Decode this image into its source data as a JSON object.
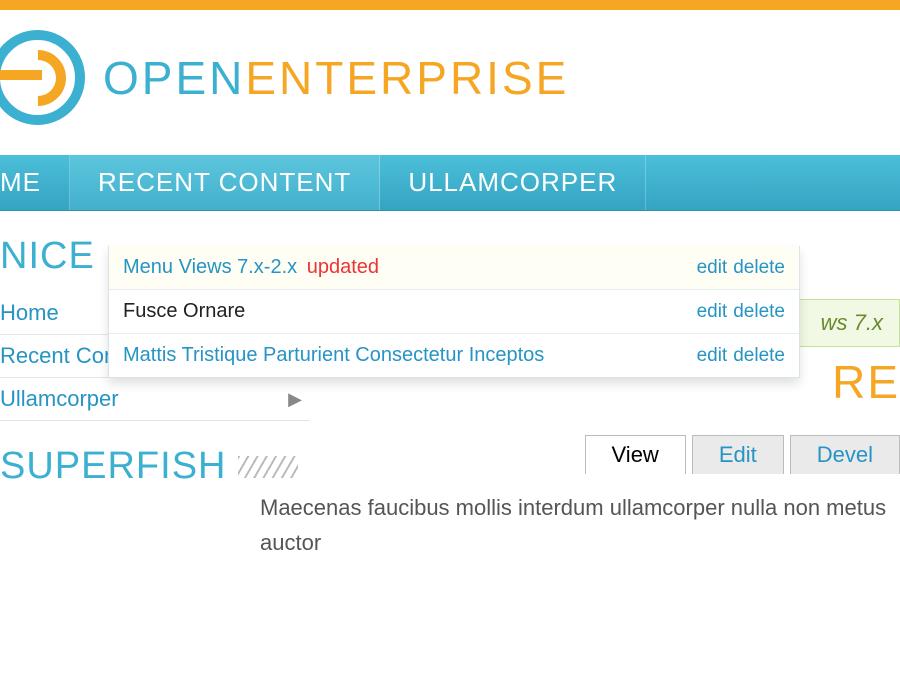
{
  "brand": {
    "word1": "OPEN",
    "word2": "ENTERPRISE"
  },
  "nav": [
    {
      "label": "HOME",
      "cropped": "ME"
    },
    {
      "label": "RECENT CONTENT",
      "active": true
    },
    {
      "label": "ULLAMCORPER"
    }
  ],
  "dropdown": [
    {
      "title": "Menu Views 7.x-2.x",
      "badge": "updated",
      "link": true,
      "highlight": true,
      "edit": "edit",
      "delete": "delete"
    },
    {
      "title": "Fusce Ornare",
      "link": false,
      "edit": "edit",
      "delete": "delete"
    },
    {
      "title": "Mattis Tristique Parturient Consectetur Inceptos",
      "link": true,
      "edit": "edit",
      "delete": "delete"
    }
  ],
  "sidebar": {
    "block1_title": "NICE",
    "block2_title": "SUPERFISH",
    "items": [
      {
        "label": "Home",
        "expandable": false
      },
      {
        "label": "Recent Content",
        "expandable": true
      },
      {
        "label": "Ullamcorper",
        "expandable": true
      }
    ]
  },
  "main": {
    "green_strip": "ws 7.x",
    "heading_fragment": "RE",
    "tabs": [
      {
        "label": "View",
        "active": true
      },
      {
        "label": "Edit"
      },
      {
        "label": "Devel"
      }
    ],
    "paragraph": "Maecenas faucibus mollis interdum ullamcorper nulla non metus auctor"
  }
}
